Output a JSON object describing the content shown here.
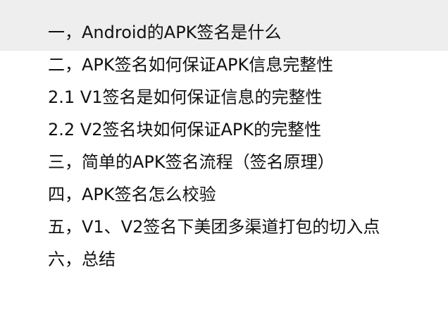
{
  "toc": {
    "active_index": 0,
    "items": [
      {
        "label": "一，Android的APK签名是什么"
      },
      {
        "label": "二，APK签名如何保证APK信息完整性"
      },
      {
        "label": "2.1 V1签名是如何保证信息的完整性"
      },
      {
        "label": "2.2 V2签名块如何保证APK的完整性"
      },
      {
        "label": "三，简单的APK签名流程（签名原理）"
      },
      {
        "label": "四，APK签名怎么校验"
      },
      {
        "label": "五，V1、V2签名下美团多渠道打包的切入点"
      },
      {
        "label": "六，总结"
      }
    ]
  },
  "colors": {
    "text": "#111111",
    "active_background": "#eeeeee",
    "background": "#ffffff"
  }
}
